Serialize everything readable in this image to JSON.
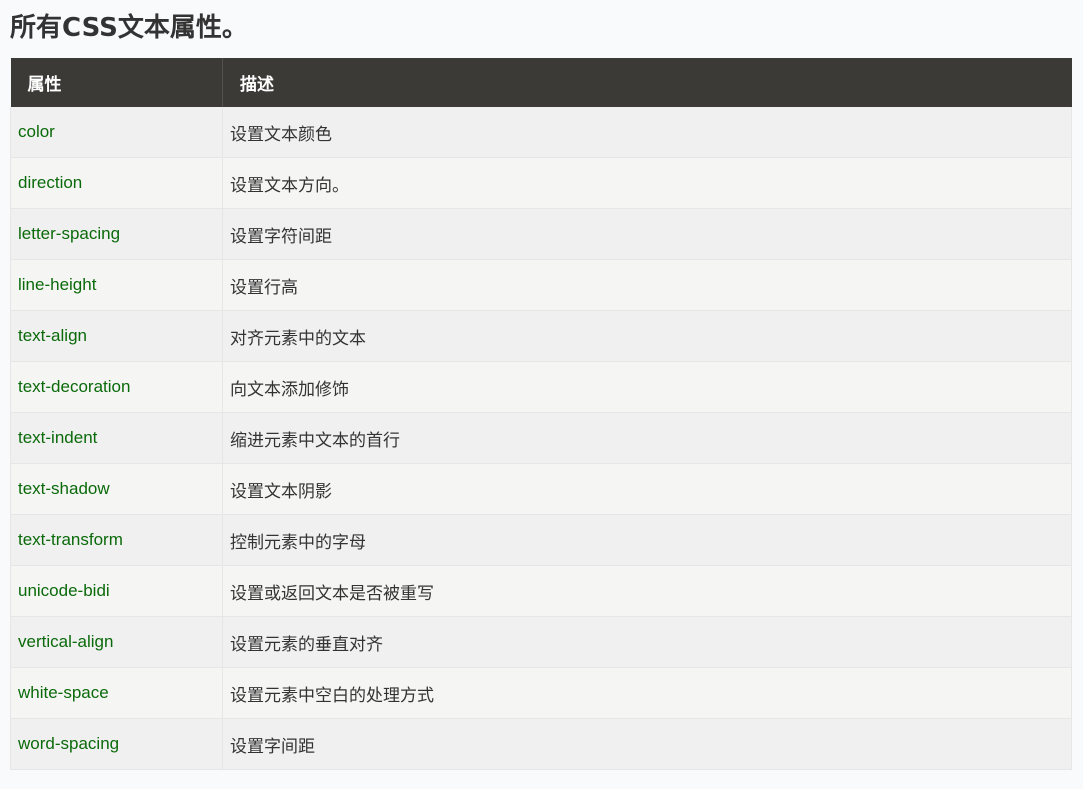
{
  "title": "所有CSS文本属性。",
  "table": {
    "headers": [
      "属性",
      "描述"
    ],
    "rows": [
      {
        "property": "color",
        "description": "设置文本颜色"
      },
      {
        "property": "direction",
        "description": "设置文本方向。"
      },
      {
        "property": "letter-spacing",
        "description": "设置字符间距"
      },
      {
        "property": "line-height",
        "description": "设置行高"
      },
      {
        "property": "text-align",
        "description": "对齐元素中的文本"
      },
      {
        "property": "text-decoration",
        "description": "向文本添加修饰"
      },
      {
        "property": "text-indent",
        "description": "缩进元素中文本的首行"
      },
      {
        "property": "text-shadow",
        "description": "设置文本阴影"
      },
      {
        "property": "text-transform",
        "description": "控制元素中的字母"
      },
      {
        "property": "unicode-bidi",
        "description": "设置或返回文本是否被重写"
      },
      {
        "property": "vertical-align",
        "description": "设置元素的垂直对齐"
      },
      {
        "property": "white-space",
        "description": "设置元素中空白的处理方式"
      },
      {
        "property": "word-spacing",
        "description": "设置字间距"
      }
    ]
  },
  "colors": {
    "header_bg": "#3c3a37",
    "property_text": "#0a6a0a",
    "row_odd": "#f0f0f0",
    "row_even": "#f5f5f4"
  }
}
